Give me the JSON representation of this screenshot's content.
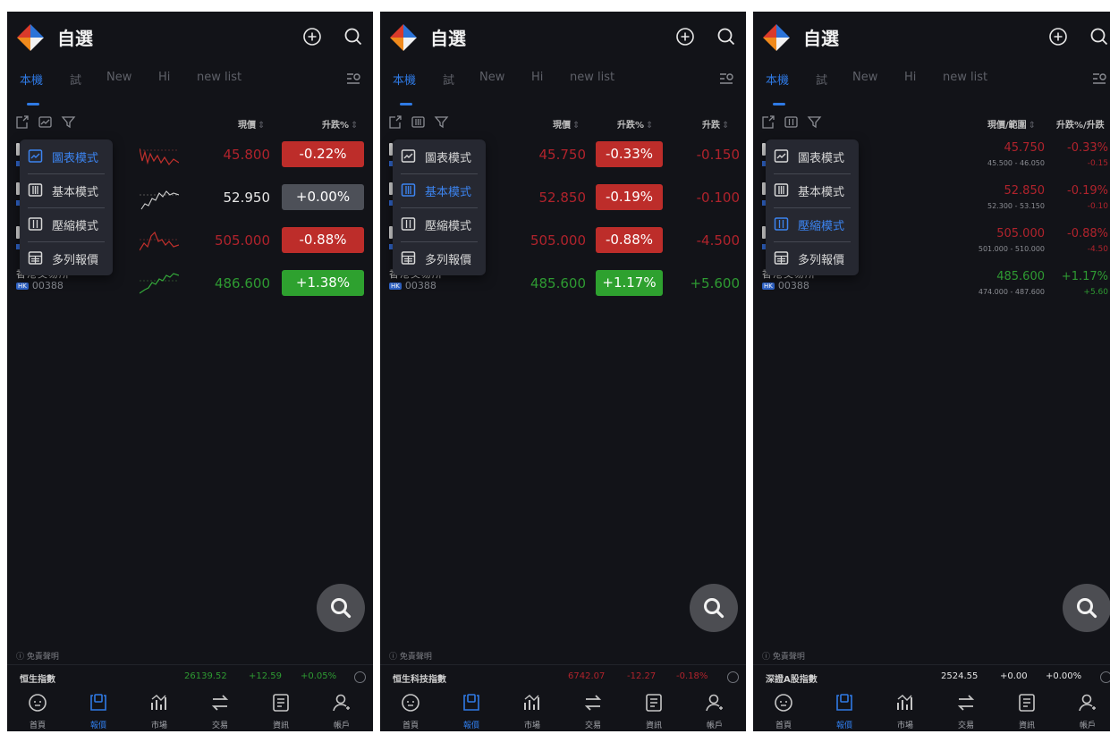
{
  "app": {
    "title": "自選"
  },
  "tabs": [
    "本機",
    "試",
    "New",
    "Hi",
    "new list"
  ],
  "columns": {
    "price": "現價",
    "change_pct": "升跌%",
    "change": "升跌",
    "price_range": "現價/範圍",
    "pct_change": "升跌%/升跌",
    "sort_arrow": "⇕"
  },
  "view_menu": {
    "items": [
      "圖表模式",
      "基本模式",
      "壓縮模式",
      "多列報價"
    ],
    "selected_by_screen": [
      "圖表模式",
      "基本模式",
      "壓縮模式"
    ]
  },
  "partial_stock": {
    "name_fragment": "香港交易所",
    "code": "00388",
    "market_badge": "HK"
  },
  "screens": [
    {
      "mode": "圖表模式",
      "rows": [
        {
          "price": "45.800",
          "change_pct": "-0.22%",
          "color": "red"
        },
        {
          "price": "52.950",
          "change_pct": "+0.00%",
          "color": "neutral"
        },
        {
          "price": "505.000",
          "change_pct": "-0.88%",
          "color": "red"
        },
        {
          "price": "486.600",
          "change_pct": "+1.38%",
          "color": "green"
        }
      ],
      "index": {
        "name": "恒生指數",
        "value": "26139.52",
        "change": "+12.59",
        "change_pct": "+0.05%",
        "color": "green"
      }
    },
    {
      "mode": "基本模式",
      "rows": [
        {
          "price": "45.750",
          "change_pct": "-0.33%",
          "change": "-0.150",
          "color": "red"
        },
        {
          "price": "52.850",
          "change_pct": "-0.19%",
          "change": "-0.100",
          "color": "red"
        },
        {
          "price": "505.000",
          "change_pct": "-0.88%",
          "change": "-4.500",
          "color": "red"
        },
        {
          "price": "485.600",
          "change_pct": "+1.17%",
          "change": "+5.600",
          "color": "green"
        }
      ],
      "index": {
        "name": "恒生科技指數",
        "value": "6742.07",
        "change": "-12.27",
        "change_pct": "-0.18%",
        "color": "red"
      }
    },
    {
      "mode": "壓縮模式",
      "rows": [
        {
          "price": "45.750",
          "range": "45.500 - 46.050",
          "change_pct": "-0.33%",
          "change": "-0.15",
          "color": "red"
        },
        {
          "price": "52.850",
          "range": "52.300 - 53.150",
          "change_pct": "-0.19%",
          "change": "-0.10",
          "color": "red"
        },
        {
          "price": "505.000",
          "range": "501.000 - 510.000",
          "change_pct": "-0.88%",
          "change": "-4.50",
          "color": "red"
        },
        {
          "price": "485.600",
          "range": "474.000 - 487.600",
          "change_pct": "+1.17%",
          "change": "+5.60",
          "color": "green"
        }
      ],
      "index": {
        "name": "深證A股指數",
        "value": "2524.55",
        "change": "+0.00",
        "change_pct": "+0.00%",
        "color": "neutral"
      }
    }
  ],
  "disclaimer": "免責聲明",
  "bottom_nav": [
    "首頁",
    "報價",
    "市場",
    "交易",
    "資訊",
    "帳戶"
  ],
  "bottom_nav_active": "報價",
  "colors": {
    "background": "#121318",
    "accent": "#2f7ae5",
    "up": "#2e9a32",
    "down": "#bd2d2a",
    "neutral": "#4d5058"
  }
}
